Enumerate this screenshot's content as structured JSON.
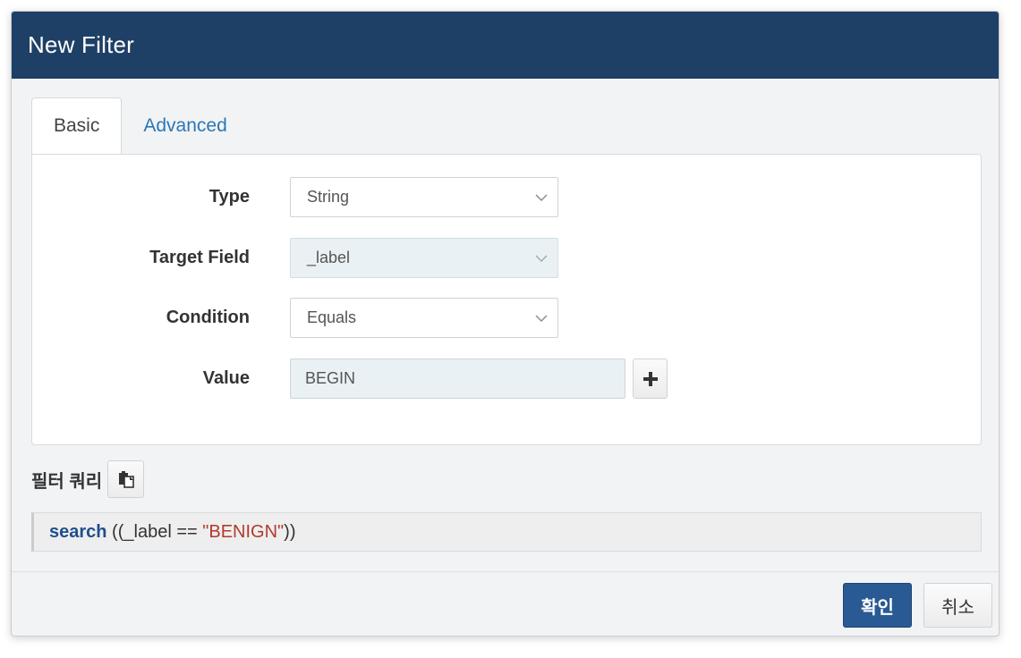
{
  "dialog": {
    "title": "New Filter"
  },
  "tabs": [
    {
      "label": "Basic",
      "active": true
    },
    {
      "label": "Advanced",
      "active": false
    }
  ],
  "form": {
    "type": {
      "label": "Type",
      "value": "String"
    },
    "target_field": {
      "label": "Target Field",
      "value": "_label",
      "disabled": true
    },
    "condition": {
      "label": "Condition",
      "value": "Equals"
    },
    "value": {
      "label": "Value",
      "value": "BEGIN",
      "add_icon": "plus-icon"
    }
  },
  "query": {
    "label": "필터 쿼리",
    "copy_icon": "clipboard-icon",
    "keyword": "search",
    "open": " ((",
    "field": "_label",
    "operator": " == ",
    "string_value": "\"BENIGN\"",
    "close": "))"
  },
  "footer": {
    "ok_label": "확인",
    "cancel_label": "취소"
  },
  "colors": {
    "header_bg": "#1e3f66",
    "primary_button": "#295a93",
    "tab_link": "#2a77b8",
    "query_keyword": "#1f4f8c",
    "query_string": "#b23a2e"
  }
}
